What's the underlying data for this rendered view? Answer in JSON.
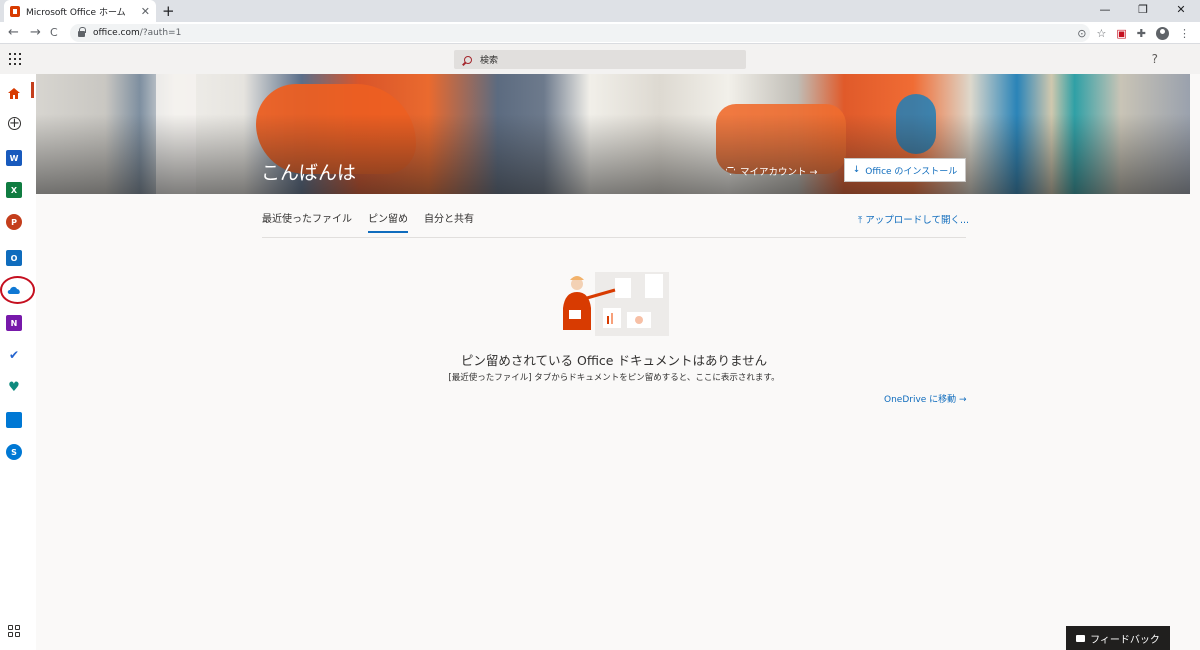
{
  "browser": {
    "tab_title": "Microsoft Office ホーム",
    "tab_close": "✕",
    "new_tab": "+",
    "url_host": "office.com",
    "url_rest": "/?auth=1",
    "back": "←",
    "forward": "→",
    "reload": "C",
    "window_controls": [
      "—",
      "❐",
      "✕"
    ]
  },
  "suite": {
    "search_placeholder": "検索",
    "help": "?"
  },
  "rail": {
    "items": [
      {
        "name": "home",
        "color": "#d83b01",
        "label": ""
      },
      {
        "name": "create",
        "color": "#ffffff",
        "label": "+"
      },
      {
        "name": "word",
        "color": "#185abd",
        "label": "W"
      },
      {
        "name": "excel",
        "color": "#107c41",
        "label": "X"
      },
      {
        "name": "powerpoint",
        "color": "#c43e1c",
        "label": "P"
      },
      {
        "name": "outlook",
        "color": "#0f6cbd",
        "label": "O"
      },
      {
        "name": "onedrive",
        "color": "#0f78d4",
        "label": ""
      },
      {
        "name": "onenote",
        "color": "#7719aa",
        "label": "N"
      },
      {
        "name": "todo",
        "color": "#2564cf",
        "label": "✔"
      },
      {
        "name": "family-safety",
        "color": "#0e8a7e",
        "label": "♥"
      },
      {
        "name": "calendar",
        "color": "#0078d4",
        "label": ""
      },
      {
        "name": "skype",
        "color": "#0078d4",
        "label": "S"
      }
    ]
  },
  "hero": {
    "greeting": "こんばんは",
    "my_account": "マイアカウント →",
    "install": "Office のインストール"
  },
  "tabs": [
    {
      "label": "最近使ったファイル",
      "active": false
    },
    {
      "label": "ピン留め",
      "active": true
    },
    {
      "label": "自分と共有",
      "active": false
    }
  ],
  "upload": "アップロードして開く...",
  "empty": {
    "title": "ピン留めされている Office ドキュメントはありません",
    "subtitle": "[最近使ったファイル] タブからドキュメントをピン留めすると、ここに表示されます。",
    "onedrive_link": "OneDrive に移動 →"
  },
  "feedback": "フィードバック",
  "colors": {
    "accent": "#0f6cbd",
    "brand": "#d83b01",
    "highlight_circle": "#c50f1f"
  }
}
